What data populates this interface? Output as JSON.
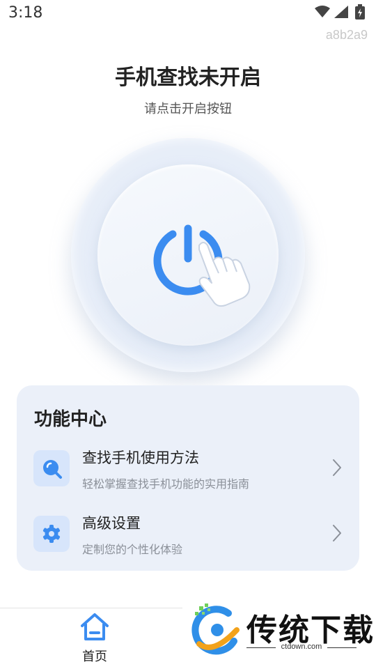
{
  "status_bar": {
    "time": "3:18"
  },
  "device_id": "a8b2a9",
  "header": {
    "title": "手机查找未开启",
    "subtitle": "请点击开启按钮"
  },
  "power_button": {
    "accent_color": "#3b8cf0"
  },
  "function_center": {
    "title": "功能中心",
    "items": [
      {
        "name": "查找手机使用方法",
        "desc": "轻松掌握查找手机功能的实用指南",
        "icon": "search-icon"
      },
      {
        "name": "高级设置",
        "desc": "定制您的个性化体验",
        "icon": "gear-icon"
      }
    ]
  },
  "bottom_nav": {
    "home_label": "首页",
    "home_icon": "home-icon"
  },
  "watermark": {
    "brand": "传统下载",
    "url": "ctdown.com"
  }
}
